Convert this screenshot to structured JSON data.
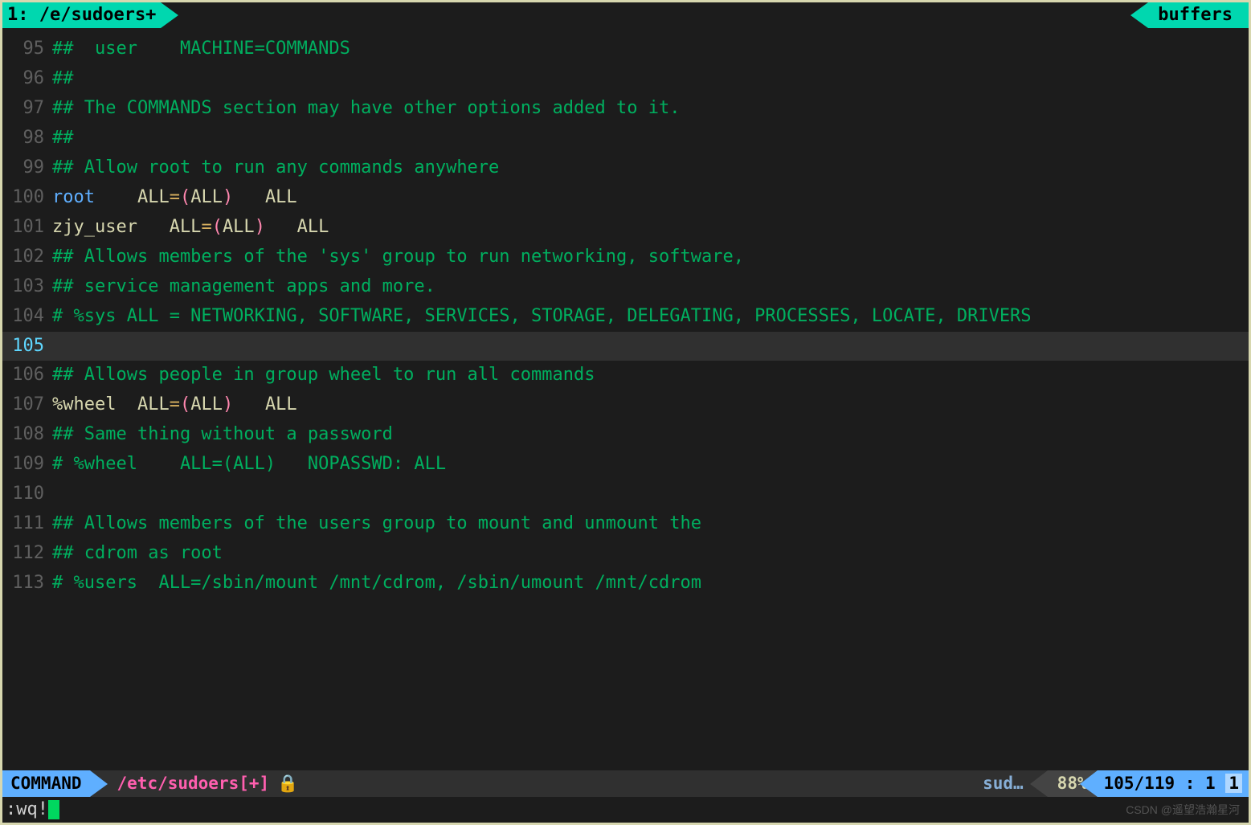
{
  "top": {
    "left": " 1: /e/sudoers+ ",
    "right": "buffers "
  },
  "lines": [
    {
      "n": "95",
      "segs": [
        {
          "c": "cmt",
          "t": "##  user    MACHINE=COMMANDS"
        }
      ]
    },
    {
      "n": "96",
      "segs": [
        {
          "c": "cmt",
          "t": "##"
        }
      ]
    },
    {
      "n": "97",
      "segs": [
        {
          "c": "cmt",
          "t": "## The COMMANDS section may have other options added to it."
        }
      ]
    },
    {
      "n": "98",
      "segs": [
        {
          "c": "cmt",
          "t": "##"
        }
      ]
    },
    {
      "n": "99",
      "segs": [
        {
          "c": "cmt",
          "t": "## Allow root to run any commands anywhere"
        }
      ]
    },
    {
      "n": "100",
      "segs": [
        {
          "c": "kw-root",
          "t": "root"
        },
        {
          "c": "white",
          "t": "    ALL"
        },
        {
          "c": "eq",
          "t": "="
        },
        {
          "c": "paren",
          "t": "("
        },
        {
          "c": "white",
          "t": "ALL"
        },
        {
          "c": "paren",
          "t": ")"
        },
        {
          "c": "white",
          "t": "   ALL"
        }
      ]
    },
    {
      "n": "101",
      "segs": [
        {
          "c": "white",
          "t": "zjy_user   ALL"
        },
        {
          "c": "eq",
          "t": "="
        },
        {
          "c": "paren",
          "t": "("
        },
        {
          "c": "white",
          "t": "ALL"
        },
        {
          "c": "paren",
          "t": ")"
        },
        {
          "c": "white",
          "t": "   ALL"
        }
      ]
    },
    {
      "n": "102",
      "segs": [
        {
          "c": "cmt",
          "t": "## Allows members of the 'sys' group to run networking, software,"
        }
      ]
    },
    {
      "n": "103",
      "segs": [
        {
          "c": "cmt",
          "t": "## service management apps and more."
        }
      ]
    },
    {
      "n": "104",
      "segs": [
        {
          "c": "cmt",
          "t": "# %sys ALL = NETWORKING, SOFTWARE, SERVICES, STORAGE, DELEGATING, PROCESSES, LOCATE, DRIVERS"
        }
      ]
    },
    {
      "n": "105",
      "current": true,
      "segs": [
        {
          "c": "",
          "t": ""
        }
      ]
    },
    {
      "n": "106",
      "segs": [
        {
          "c": "cmt",
          "t": "## Allows people in group wheel to run all commands"
        }
      ]
    },
    {
      "n": "107",
      "segs": [
        {
          "c": "white",
          "t": "%wheel  ALL"
        },
        {
          "c": "eq",
          "t": "="
        },
        {
          "c": "paren",
          "t": "("
        },
        {
          "c": "white",
          "t": "ALL"
        },
        {
          "c": "paren",
          "t": ")"
        },
        {
          "c": "white",
          "t": "   ALL"
        }
      ]
    },
    {
      "n": "108",
      "segs": [
        {
          "c": "cmt",
          "t": "## Same thing without a password"
        }
      ]
    },
    {
      "n": "109",
      "segs": [
        {
          "c": "cmt",
          "t": "# %wheel    ALL=(ALL)   NOPASSWD: ALL"
        }
      ]
    },
    {
      "n": "110",
      "segs": [
        {
          "c": "",
          "t": ""
        }
      ]
    },
    {
      "n": "111",
      "segs": [
        {
          "c": "cmt",
          "t": "## Allows members of the users group to mount and unmount the"
        }
      ]
    },
    {
      "n": "112",
      "segs": [
        {
          "c": "cmt",
          "t": "## cdrom as root"
        }
      ]
    },
    {
      "n": "113",
      "segs": [
        {
          "c": "cmt",
          "t": "# %users  ALL=/sbin/mount /mnt/cdrom, /sbin/umount /mnt/cdrom"
        }
      ]
    }
  ],
  "status": {
    "mode": " COMMAND ",
    "file": "/etc/sudoers[+]",
    "lock": "🔒",
    "filetype": "sud…",
    "percent": "88%",
    "pos": "105/119 :  1",
    "col_end": "1"
  },
  "cmdline": ":wq!",
  "watermark": "CSDN @遥望浩瀚星河"
}
